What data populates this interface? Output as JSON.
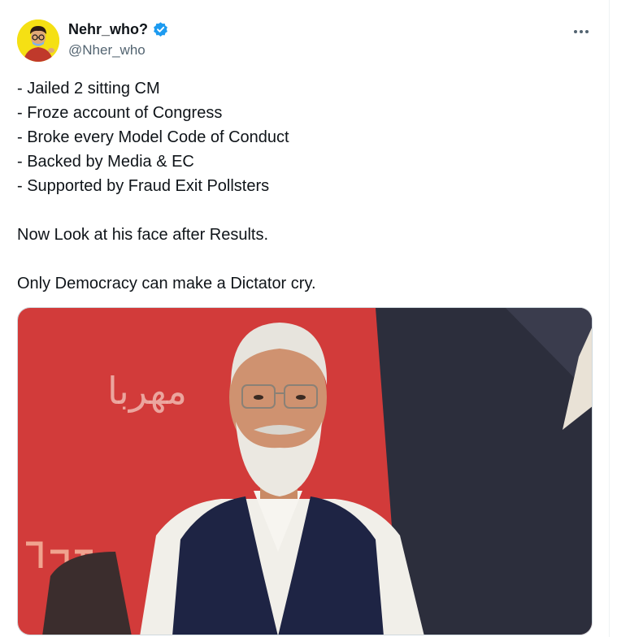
{
  "author": {
    "display_name": "Nehr_who?",
    "handle": "@Nher_who",
    "verified": true,
    "avatar_icon": "cartoon-avatar-icon"
  },
  "more_icon": "more-horizontal-icon",
  "tweet": {
    "lines": [
      "- Jailed 2 sitting CM",
      "- Froze account of Congress",
      "- Broke every Model Code of Conduct",
      "- Backed by Media & EC",
      "- Supported by Fraud Exit Pollsters",
      "",
      "Now Look at his face after Results.",
      "",
      "Only Democracy can make a Dictator cry."
    ]
  },
  "media": {
    "background_script_text": "مهربا",
    "description_icon": "man-in-vest-photo"
  },
  "colors": {
    "verified_blue": "#1d9bf0",
    "avatar_bg": "#f5e014",
    "media_red": "#d03a3a",
    "media_dark": "#2b2d3a"
  }
}
